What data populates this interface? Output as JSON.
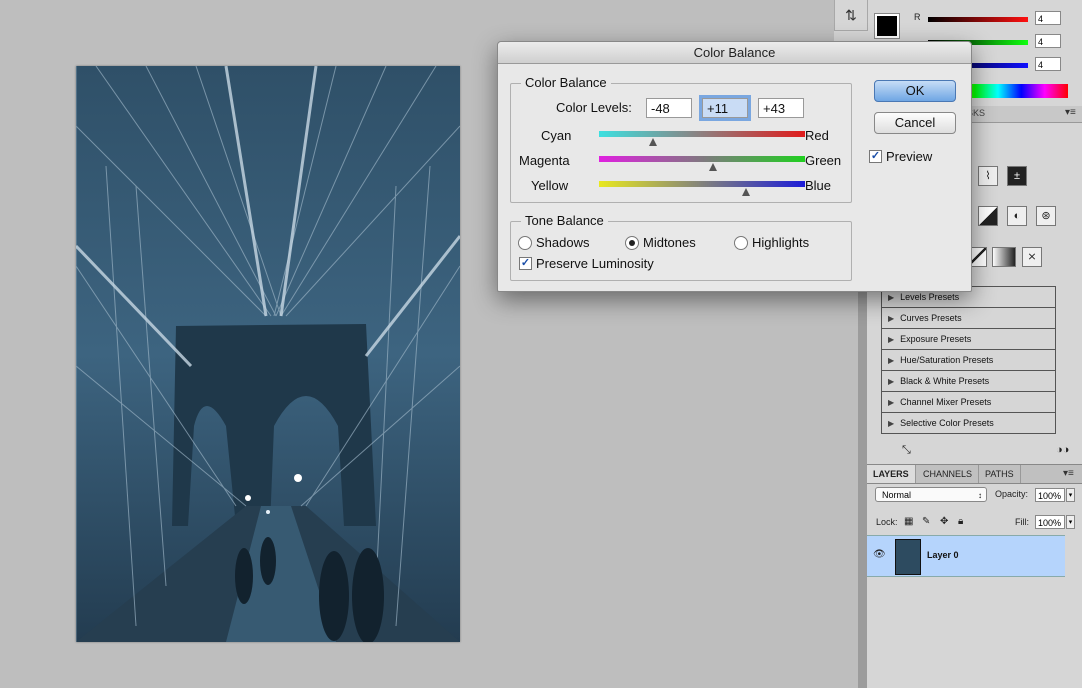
{
  "dialog": {
    "title": "Color Balance",
    "color_balance_group": "Color Balance",
    "color_levels_label": "Color Levels:",
    "levels": [
      "-48",
      "+11",
      "+43"
    ],
    "sliders": [
      {
        "left": "Cyan",
        "right": "Red",
        "value": -48
      },
      {
        "left": "Magenta",
        "right": "Green",
        "value": 11
      },
      {
        "left": "Yellow",
        "right": "Blue",
        "value": 43
      }
    ],
    "tone_balance_group": "Tone Balance",
    "tones": [
      "Shadows",
      "Midtones",
      "Highlights"
    ],
    "selected_tone": "Midtones",
    "preserve_luminosity": "Preserve Luminosity",
    "ok": "OK",
    "cancel": "Cancel",
    "preview": "Preview"
  },
  "color_panel": {
    "channels": [
      {
        "name": "R",
        "value": "4",
        "color": "#d01818"
      },
      {
        "name": "",
        "value": "4",
        "color": "#18c018"
      },
      {
        "name": "",
        "value": "4",
        "color": "#1818d0"
      }
    ]
  },
  "adjustments": {
    "header_suffix": "SKS",
    "presets": [
      "Levels Presets",
      "Curves Presets",
      "Exposure Presets",
      "Hue/Saturation Presets",
      "Black & White Presets",
      "Channel Mixer Presets",
      "Selective Color Presets"
    ]
  },
  "layers": {
    "tabs": [
      "LAYERS",
      "CHANNELS",
      "PATHS"
    ],
    "blend_mode": "Normal",
    "opacity_label": "Opacity:",
    "opacity": "100%",
    "lock_label": "Lock:",
    "fill_label": "Fill:",
    "fill": "100%",
    "layer_name": "Layer 0"
  },
  "photo_tint": "#2c4a60"
}
